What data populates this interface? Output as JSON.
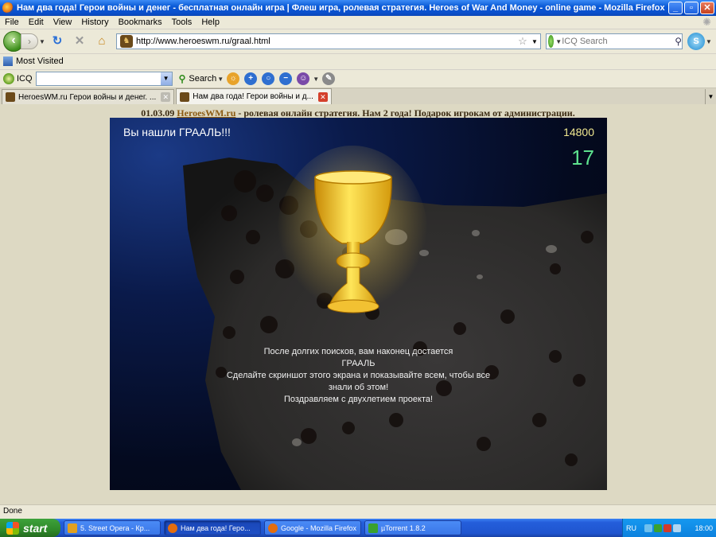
{
  "window": {
    "title": "Нам два года! Герои войны и денег - бесплатная онлайн игра | Флеш игра, ролевая стратегия. Heroes of War And Money - online game - Mozilla Firefox",
    "minimize": "_",
    "maximize": "▫",
    "close": "✕"
  },
  "menu": [
    "File",
    "Edit",
    "View",
    "History",
    "Bookmarks",
    "Tools",
    "Help"
  ],
  "nav": {
    "url": "http://www.heroeswm.ru/graal.html",
    "search_placeholder": "ICQ Search"
  },
  "bookmarks": {
    "most_visited": "Most Visited"
  },
  "icq_toolbar": {
    "label": "ICQ",
    "search_label": "Search"
  },
  "tabs": [
    {
      "label": "HeroesWM.ru Герои войны и денег. ...",
      "active": false
    },
    {
      "label": "Нам два года! Герои войны и д...",
      "active": true
    }
  ],
  "page": {
    "date": "01.03.09",
    "site_link": "HeroesWM.ru",
    "announcement": "- ролевая онлайн стратегия. Нам 2 года! Подарок игрокам от администрации."
  },
  "game": {
    "found_text": "Вы нашли ГРААЛЬ!!!",
    "score": "14800",
    "counter": "17",
    "message_lines": [
      "После долгих поисков, вам наконец достается",
      "ГРААЛЬ",
      "Сделайте скриншот этого экрана и показывайте всем, чтобы все",
      "знали об этом!",
      "Поздравляем с двухлетием проекта!"
    ]
  },
  "status": "Done",
  "taskbar": {
    "start": "start",
    "tasks": [
      {
        "label": "5. Street Opera - Кр...",
        "active": false,
        "icon_color": "#e0a020"
      },
      {
        "label": "Нам два года! Геро...",
        "active": true,
        "icon_color": "#e46d0e"
      },
      {
        "label": "Google - Mozilla Firefox",
        "active": false,
        "icon_color": "#e46d0e"
      },
      {
        "label": "µTorrent 1.8.2",
        "active": false,
        "icon_color": "#3aa12f"
      }
    ],
    "tray_lang": "RU",
    "clock": "18:00"
  }
}
